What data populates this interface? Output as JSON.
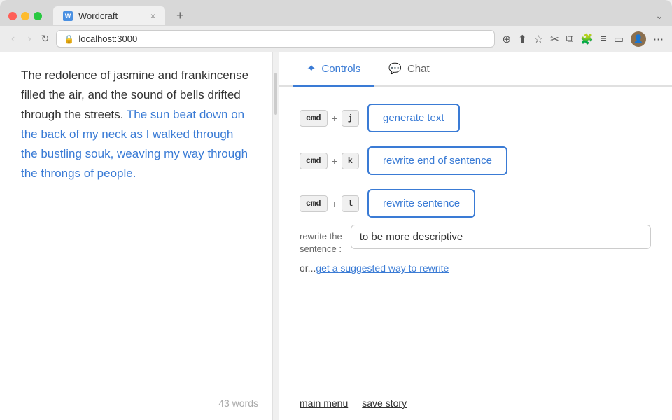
{
  "browser": {
    "tab_title": "Wordcraft",
    "url": "localhost:3000",
    "tab_close": "×",
    "tab_new": "+",
    "tab_end": "⌄"
  },
  "editor": {
    "normal_text": "The redolence of jasmine and frankincense filled the air, and the sound of bells drifted through the streets.",
    "highlighted_text": "The sun beat down on the back of my neck as I walked through the bustling souk, weaving my way through the throngs of people.",
    "word_count": "43 words"
  },
  "controls": {
    "tab_controls": "Controls",
    "tab_chat": "Chat",
    "commands": [
      {
        "modifier": "cmd",
        "plus": "+",
        "key": "j",
        "label": "generate text"
      },
      {
        "modifier": "cmd",
        "plus": "+",
        "key": "k",
        "label": "rewrite end of sentence"
      },
      {
        "modifier": "cmd",
        "plus": "+",
        "key": "l",
        "label": "rewrite sentence"
      }
    ],
    "rewrite_label_line1": "rewrite the",
    "rewrite_label_line2": "sentence :",
    "rewrite_input_value": "to be more descriptive",
    "suggest_prefix": "or...",
    "suggest_link": "get a suggested way to rewrite"
  },
  "footer": {
    "main_menu": "main menu",
    "save_story": "save story"
  },
  "icons": {
    "sparkle": "✦",
    "chat": "💬",
    "lock": "🔒",
    "back": "‹",
    "forward": "›",
    "refresh": "↻",
    "zoom": "⊕",
    "share": "⬆",
    "bookmark": "☆",
    "scissors": "✂",
    "copy": "⧉",
    "puzzle": "🧩",
    "reader": "≡",
    "sidebar": "▭",
    "more": "⋯"
  }
}
